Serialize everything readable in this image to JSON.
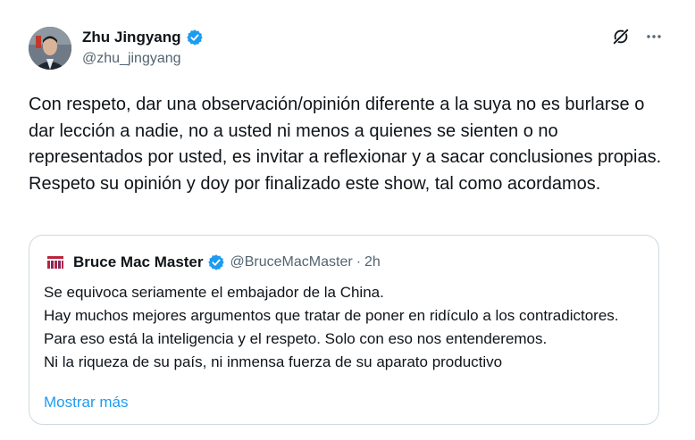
{
  "author": {
    "display_name": "Zhu Jingyang",
    "handle": "@zhu_jingyang",
    "verified": true
  },
  "icons": {
    "verified": "verified-badge-icon",
    "grok": "grok-icon",
    "more": "more-options-icon"
  },
  "colors": {
    "accent": "#1d9bf0",
    "text": "#0f1419",
    "secondary": "#536471",
    "border": "#cfd9de"
  },
  "tweet_text": "Con respeto, dar una observación/opinión diferente a la suya no es burlarse o dar lección a nadie, no a usted ni menos a quienes se sienten o no representados por usted, es invitar a reflexionar y a sacar conclusiones propias.\nRespeto su opinión y doy por finalizado este show, tal como acordamos.",
  "quote": {
    "display_name": "Bruce Mac Master",
    "handle": "@BruceMacMaster",
    "separator": "·",
    "time": "2h",
    "verified": true,
    "text": "Se equivoca seriamente el embajador de la China.\nHay muchos mejores argumentos que tratar de poner en ridículo a los contradictores.\nPara eso está la inteligencia y el respeto. Solo con eso nos entenderemos.\nNi la riqueza de su país, ni inmensa fuerza de su aparato productivo",
    "show_more": "Mostrar más"
  }
}
